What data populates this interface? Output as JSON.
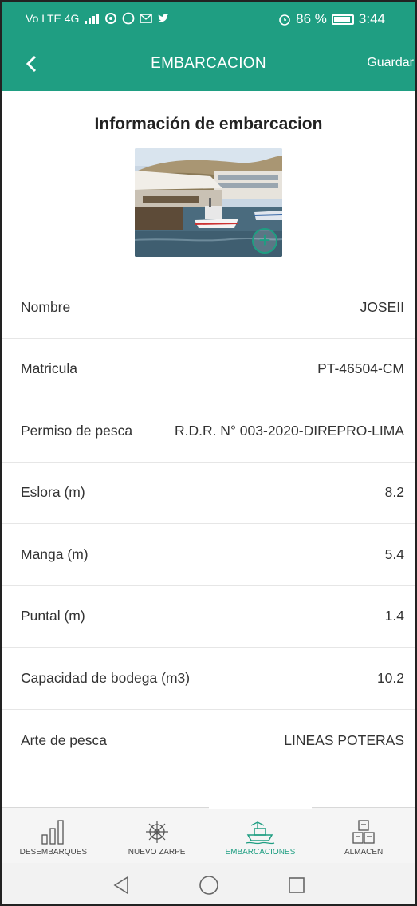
{
  "status_bar": {
    "left_text": "Vo LTE 4G",
    "battery_percent": "86 %",
    "time": "3:44"
  },
  "app_bar": {
    "back_icon": "chevron-left-icon",
    "title": "EMBARCACION",
    "save_label": "Guardar"
  },
  "main": {
    "section_title": "Información de embarcacion",
    "photo_action_icon": "plus-circle-icon",
    "fields": [
      {
        "label": "Nombre",
        "value": "JOSEII"
      },
      {
        "label": "Matricula",
        "value": "PT-46504-CM"
      },
      {
        "label": "Permiso de pesca",
        "value": "R.D.R. N° 003-2020-DIREPRO-LIMA"
      },
      {
        "label": "Eslora (m)",
        "value": "8.2"
      },
      {
        "label": "Manga (m)",
        "value": "5.4"
      },
      {
        "label": "Puntal (m)",
        "value": "1.4"
      },
      {
        "label": "Capacidad de bodega (m3)",
        "value": "10.2"
      },
      {
        "label": "Arte de pesca",
        "value": "LINEAS POTERAS"
      }
    ]
  },
  "bottom_nav": {
    "items": [
      {
        "label": "DESEMBARQUES",
        "icon": "bars-icon",
        "active": false
      },
      {
        "label": "NUEVO ZARPE",
        "icon": "ship-wheel-icon",
        "active": false
      },
      {
        "label": "EMBARCACIONES",
        "icon": "boat-icon",
        "active": true
      },
      {
        "label": "ALMACEN",
        "icon": "boxes-icon",
        "active": false
      }
    ]
  },
  "colors": {
    "primary": "#1f9e82",
    "text": "#333333",
    "divider": "#e6e6e6"
  }
}
